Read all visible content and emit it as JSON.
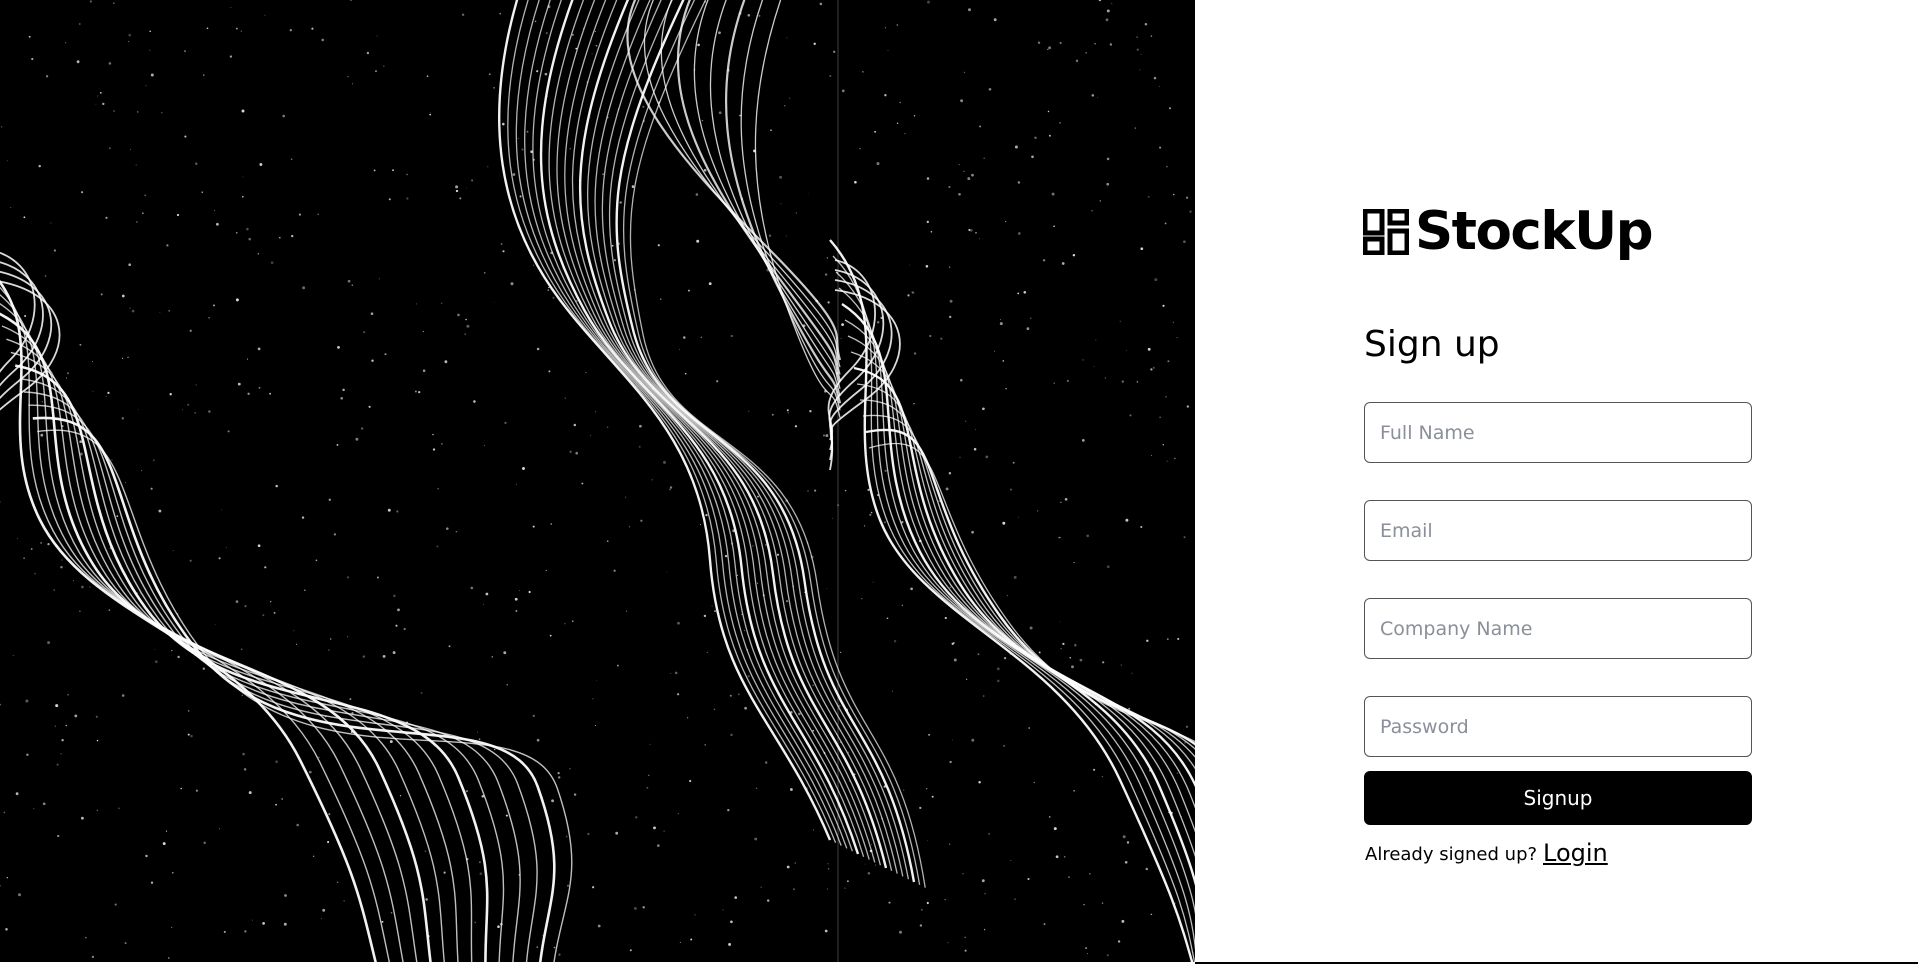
{
  "brand": {
    "name": "StockUp",
    "logo_icon": "grid-blocks-icon"
  },
  "form": {
    "heading": "Sign up",
    "fields": {
      "full_name": {
        "placeholder": "Full Name",
        "value": ""
      },
      "email": {
        "placeholder": "Email",
        "value": ""
      },
      "company_name": {
        "placeholder": "Company Name",
        "value": ""
      },
      "password": {
        "placeholder": "Password",
        "value": ""
      }
    },
    "submit_label": "Signup",
    "already_signed_up_text": "Already signed up?",
    "login_link_label": "Login"
  },
  "colors": {
    "hero_background": "#000000",
    "button_background": "#000000",
    "button_text": "#ffffff",
    "placeholder": "#8a8f99"
  }
}
